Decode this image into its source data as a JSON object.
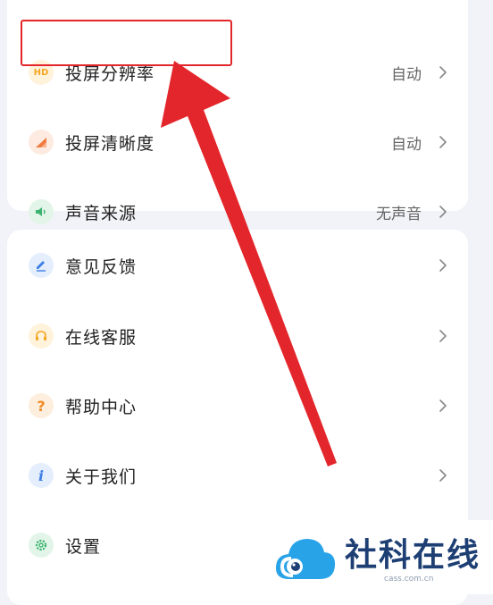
{
  "settings_group_1": {
    "items": [
      {
        "label": "投屏分辨率",
        "value": "自动",
        "icon": "hd-icon",
        "icon_text": "HD"
      },
      {
        "label": "投屏清晰度",
        "value": "自动",
        "icon": "clarity-icon"
      },
      {
        "label": "声音来源",
        "value": "无声音",
        "icon": "speaker-icon"
      }
    ]
  },
  "settings_group_2": {
    "items": [
      {
        "label": "意见反馈",
        "icon": "pencil-icon"
      },
      {
        "label": "在线客服",
        "icon": "headset-icon"
      },
      {
        "label": "帮助中心",
        "icon": "question-icon",
        "icon_text": "?"
      },
      {
        "label": "关于我们",
        "icon": "info-icon",
        "icon_text": "i"
      },
      {
        "label": "设置",
        "icon": "gear-icon"
      }
    ]
  },
  "watermark": {
    "text": "社科在线",
    "url": "cass.com.cn"
  },
  "colors": {
    "annotation": "#e3262b",
    "hd_icon": "#f5a623",
    "clarity_icon": "#f07b3f",
    "speaker_icon": "#3cb371",
    "pencil_icon": "#3d7fe6",
    "headset_icon": "#f5a623",
    "question_icon": "#f08a24",
    "info_icon": "#3d7fe6",
    "gear_icon": "#3cb371",
    "watermark_blue": "#1d3f74",
    "watermark_cloud": "#29a3e8"
  }
}
